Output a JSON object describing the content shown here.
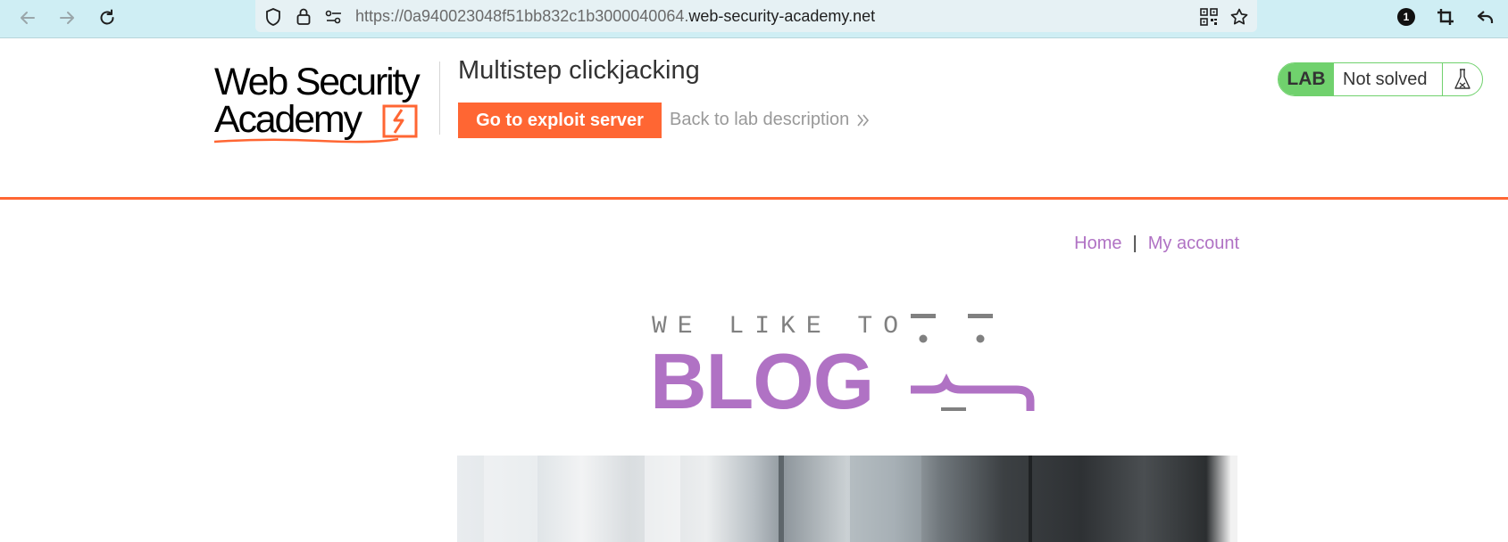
{
  "browser": {
    "url_prefix": "https://0a940023048f51bb832c1b3000040064.",
    "url_domain": "web-security-academy.net",
    "extension_badge": "1",
    "icons": [
      "back-arrow-icon",
      "forward-arrow-icon",
      "reload-icon",
      "shield-icon",
      "lock-icon",
      "site-settings-icon",
      "qr-code-icon",
      "bookmark-star-icon",
      "extension-badge-icon",
      "crop-icon",
      "reply-arrow-icon"
    ]
  },
  "lab_header": {
    "logo_line1": "Web Security",
    "logo_line2": "Academy",
    "title": "Multistep clickjacking",
    "exploit_button": "Go to exploit server",
    "back_link": "Back to lab description",
    "badge_tag": "LAB",
    "badge_status": "Not solved",
    "colors": {
      "accent": "#ff6633",
      "badge_green": "#70d16d",
      "link_purple": "#b072c4"
    }
  },
  "nav": {
    "home": "Home",
    "separator": "|",
    "account": "My account"
  },
  "banner": {
    "tagline": "WE LIKE TO",
    "word": "BLOG"
  }
}
